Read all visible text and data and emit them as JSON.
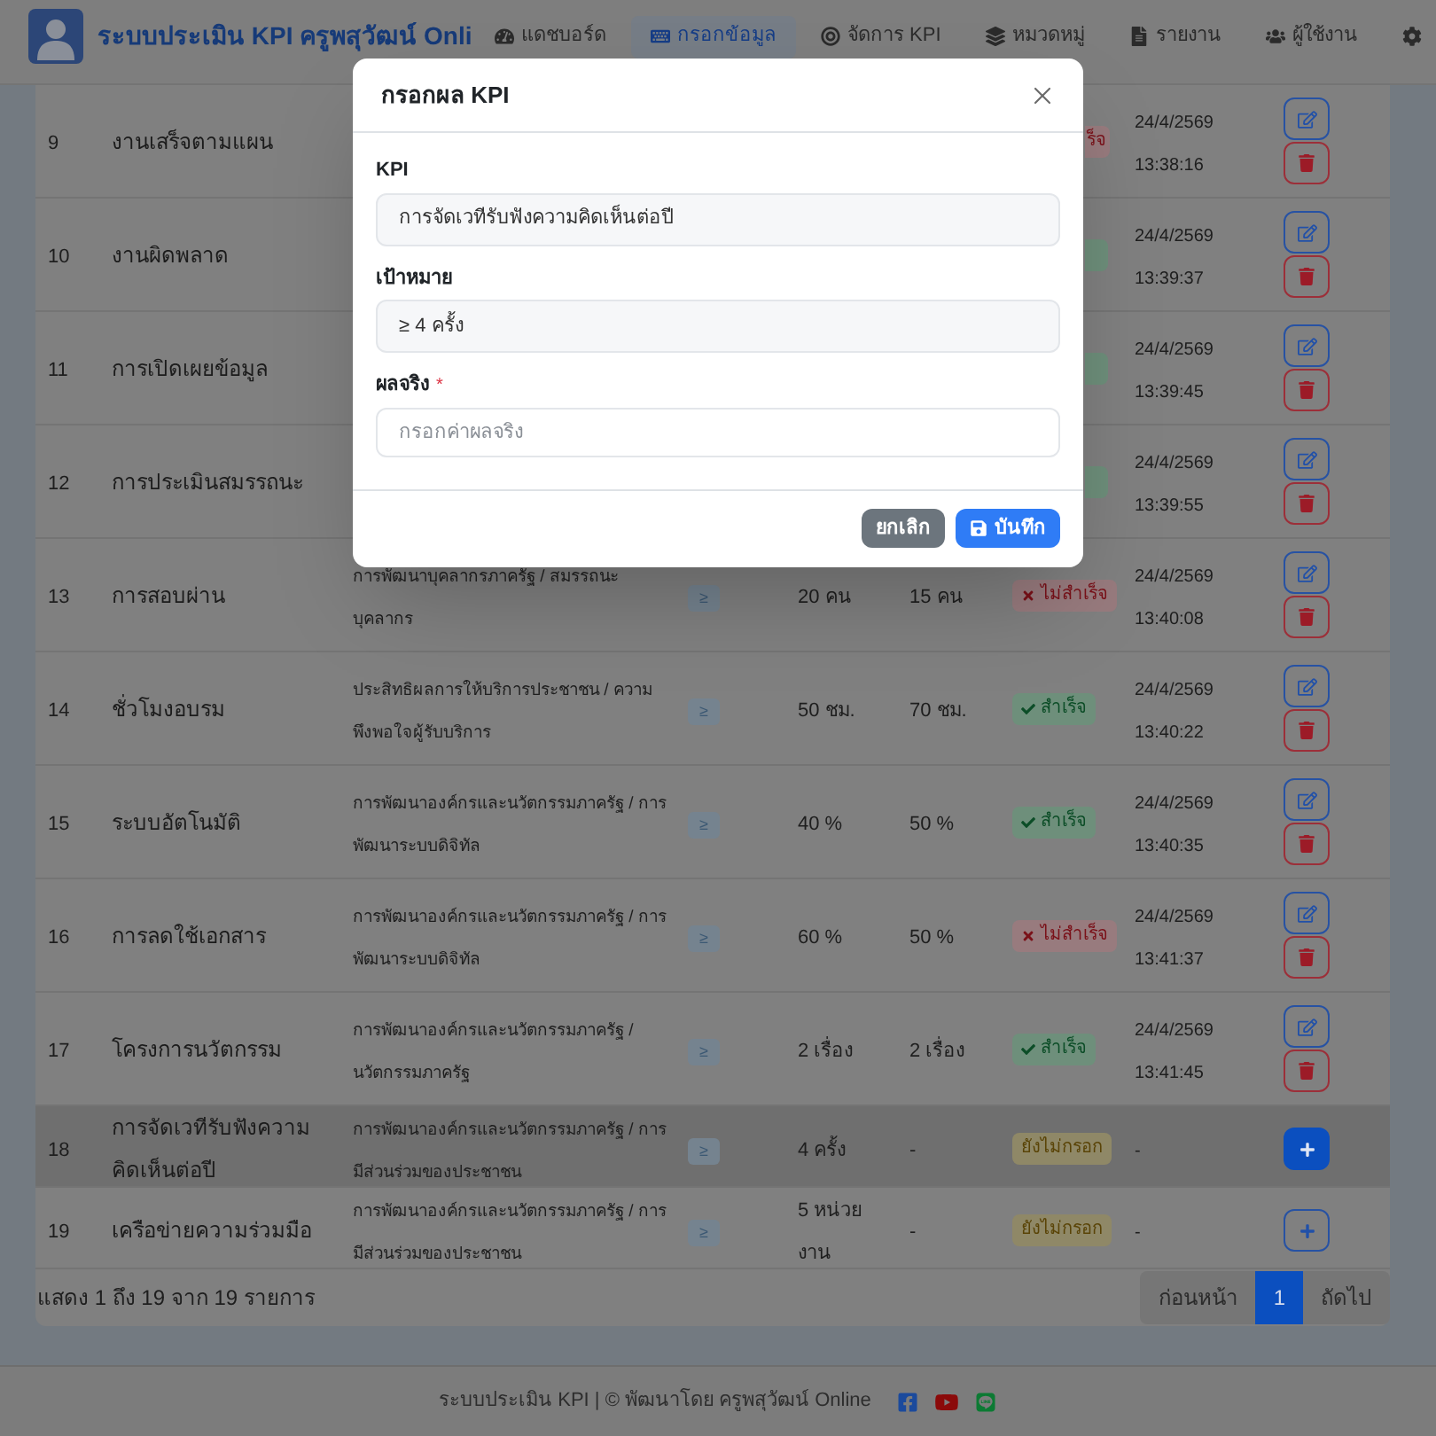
{
  "navbar": {
    "brand": "ระบบประเมิน KPI ครูพสุวัฒน์ Onli",
    "items": [
      {
        "label": "แดชบอร์ด",
        "selected": false
      },
      {
        "label": "กรอกข้อมูล",
        "selected": true
      },
      {
        "label": "จัดการ KPI",
        "selected": false
      },
      {
        "label": "หมวดหมู่",
        "selected": false
      },
      {
        "label": "รายงาน",
        "selected": false
      },
      {
        "label": "ผู้ใช้งาน",
        "selected": false
      },
      {
        "selected": false
      }
    ]
  },
  "table": {
    "rows": [
      {
        "number": "9",
        "name": "งานเสร็จตามแผน",
        "status": {
          "kind": "fail",
          "text": "ร็จ"
        },
        "updated": "24/4/2569 13:38:16",
        "kind": "entered",
        "selected": false
      },
      {
        "number": "10",
        "name": "งานผิดพลาด",
        "status": {
          "kind": "success"
        },
        "updated": "24/4/2569 13:39:37",
        "kind": "entered",
        "selected": false
      },
      {
        "number": "11",
        "name": "การเปิดเผยข้อมูล",
        "status": {
          "kind": "success"
        },
        "updated": "24/4/2569 13:39:45",
        "kind": "entered",
        "selected": false
      },
      {
        "number": "12",
        "name": "การประเมินสมรรถนะ",
        "status": {
          "kind": "success"
        },
        "updated": "24/4/2569 13:39:55",
        "kind": "entered",
        "selected": false
      },
      {
        "number": "13",
        "name": "การสอบผ่าน",
        "category": "การพัฒนาบุคลากรภาครัฐ / สมรรถนะบุคลากร",
        "operator": "≥",
        "target": "20 คน",
        "actual": "15 คน",
        "status": {
          "kind": "fail",
          "text": "ไม่สำเร็จ"
        },
        "updated": "24/4/2569 13:40:08",
        "kind": "entered",
        "selected": false
      },
      {
        "number": "14",
        "name": "ชั่วโมงอบรม",
        "category": "ประสิทธิผลการให้บริการประชาชน / ความพึงพอใจผู้รับบริการ",
        "operator": "≥",
        "target": "50 ชม.",
        "actual": "70 ชม.",
        "status": {
          "kind": "success",
          "text": "สำเร็จ"
        },
        "updated": "24/4/2569 13:40:22",
        "kind": "entered",
        "selected": false
      },
      {
        "number": "15",
        "name": "ระบบอัตโนมัติ",
        "category": "การพัฒนาองค์กรและนวัตกรรมภาครัฐ / การพัฒนาระบบดิจิทัล",
        "operator": "≥",
        "target": "40 %",
        "actual": "50 %",
        "status": {
          "kind": "success",
          "text": "สำเร็จ"
        },
        "updated": "24/4/2569 13:40:35",
        "kind": "entered",
        "selected": false
      },
      {
        "number": "16",
        "name": "การลดใช้เอกสาร",
        "category": "การพัฒนาองค์กรและนวัตกรรมภาครัฐ / การพัฒนาระบบดิจิทัล",
        "operator": "≥",
        "target": "60 %",
        "actual": "50 %",
        "status": {
          "kind": "fail",
          "text": "ไม่สำเร็จ"
        },
        "updated": "24/4/2569 13:41:37",
        "kind": "entered",
        "selected": false
      },
      {
        "number": "17",
        "name": "โครงการนวัตกรรม",
        "category": "การพัฒนาองค์กรและนวัตกรรมภาครัฐ / นวัตกรรมภาครัฐ",
        "operator": "≥",
        "target": "2 เรื่อง",
        "actual": "2 เรื่อง",
        "status": {
          "kind": "success",
          "text": "สำเร็จ"
        },
        "updated": "24/4/2569 13:41:45",
        "kind": "entered",
        "selected": false
      },
      {
        "number": "18",
        "name": "การจัดเวทีรับฟังความคิดเห็นต่อปี",
        "category": "การพัฒนาองค์กรและนวัตกรรมภาครัฐ / การมีส่วนร่วมของประชาชน",
        "operator": "≥",
        "target": "4 ครั้ง",
        "actual": "-",
        "status": {
          "kind": "pending",
          "text": "ยังไม่กรอก"
        },
        "updated": "-",
        "kind": "empty",
        "selected": true
      },
      {
        "number": "19",
        "name": "เครือข่ายความร่วมมือ",
        "category": "การพัฒนาองค์กรและนวัตกรรมภาครัฐ / การมีส่วนร่วมของประชาชน",
        "operator": "≥",
        "target": "5 หน่วยงาน",
        "actual": "-",
        "status": {
          "kind": "pending",
          "text": "ยังไม่กรอก"
        },
        "updated": "-",
        "kind": "empty",
        "selected": false
      }
    ],
    "pagination": {
      "info": "แสดง 1 ถึง 19 จาก 19 รายการ",
      "pages": [
        {
          "label": "ก่อนหน้า",
          "selected": false
        },
        {
          "label": "1",
          "selected": true
        },
        {
          "label": "ถัดไป",
          "selected": false
        }
      ]
    }
  },
  "modal": {
    "title": "กรอกผล KPI",
    "fields": [
      {
        "label": "KPI",
        "value": "การจัดเวทีรับฟังความคิดเห็นต่อปี",
        "readonly": true
      },
      {
        "label": "เป้าหมาย",
        "value": "≥ 4 ครั้ง",
        "readonly": true
      },
      {
        "label": "ผลจริง",
        "required_mark": "*",
        "placeholder": "กรอกค่าผลจริง",
        "readonly": false
      }
    ],
    "buttons": [
      {
        "label": "ยกเลิก",
        "kind": "secondary"
      },
      {
        "label": "บันทึก",
        "kind": "primary"
      }
    ]
  },
  "footer": {
    "text": "ระบบประเมิน KPI | © พัฒนาโดย ครูพสุวัฒน์ Online"
  }
}
